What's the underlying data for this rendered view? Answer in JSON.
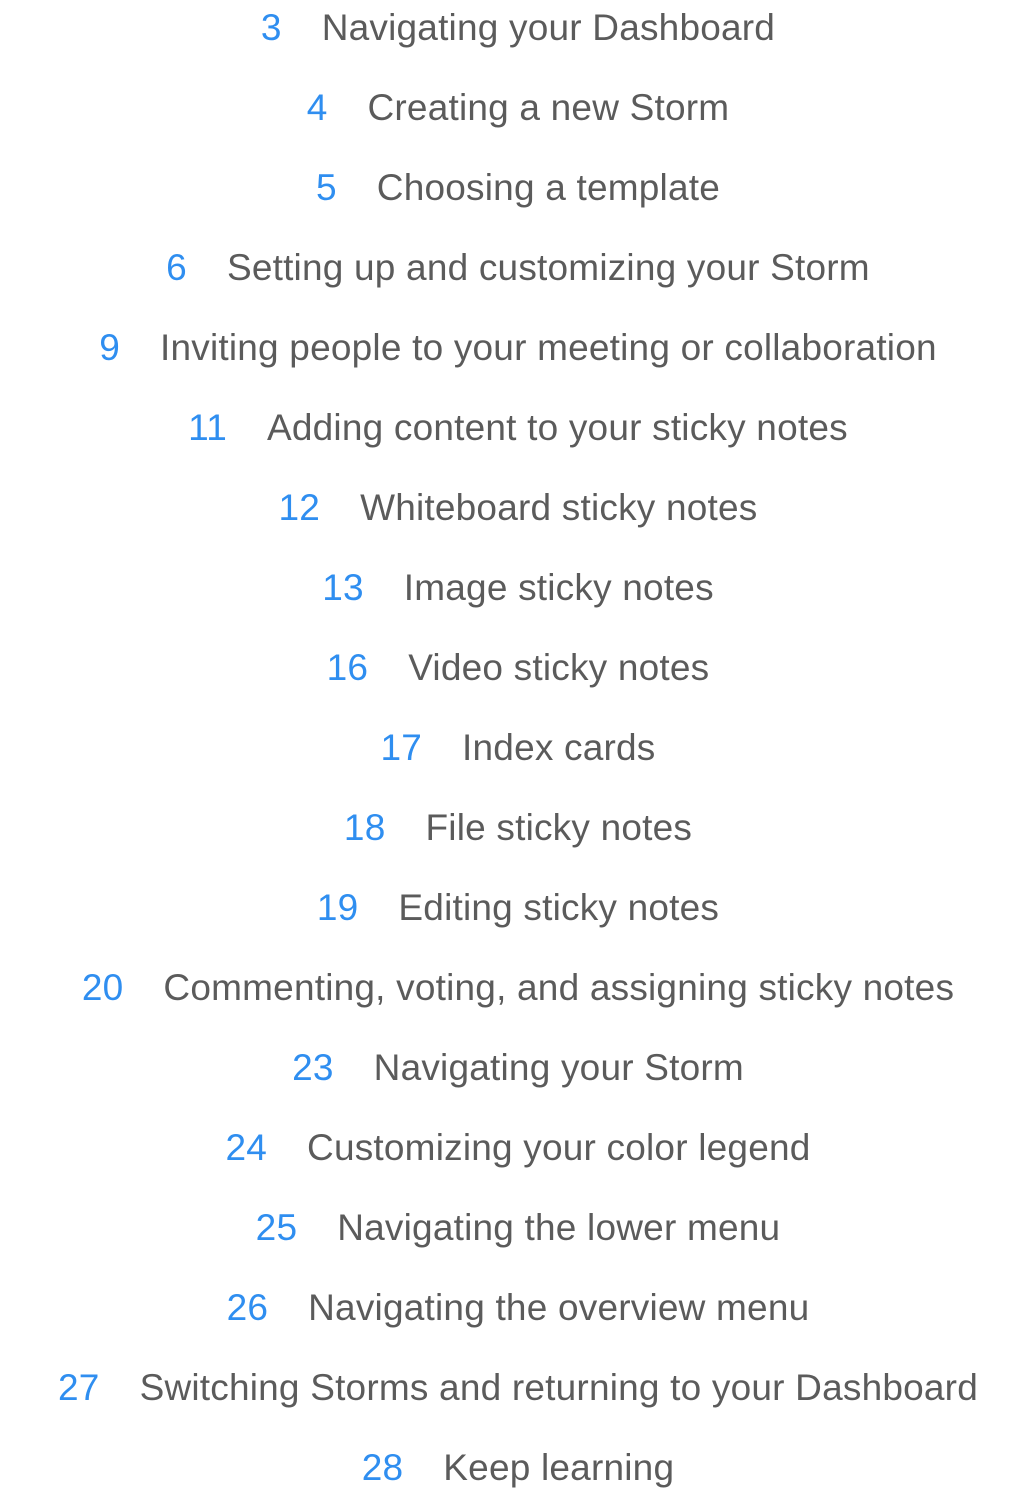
{
  "toc": {
    "accent_color": "#2f8ef0",
    "text_color": "#5b5b5b",
    "entries": [
      {
        "page": "3",
        "title": "Navigating your Dashboard"
      },
      {
        "page": "4",
        "title": "Creating a new Storm"
      },
      {
        "page": "5",
        "title": "Choosing a template"
      },
      {
        "page": "6",
        "title": "Setting up and customizing your Storm"
      },
      {
        "page": "9",
        "title": "Inviting people to your meeting or collaboration"
      },
      {
        "page": "11",
        "title": "Adding content to your sticky notes"
      },
      {
        "page": "12",
        "title": "Whiteboard sticky notes"
      },
      {
        "page": "13",
        "title": "Image sticky notes"
      },
      {
        "page": "16",
        "title": "Video sticky notes"
      },
      {
        "page": "17",
        "title": "Index cards"
      },
      {
        "page": "18",
        "title": "File sticky notes"
      },
      {
        "page": "19",
        "title": "Editing sticky notes"
      },
      {
        "page": "20",
        "title": "Commenting, voting, and assigning sticky notes"
      },
      {
        "page": "23",
        "title": "Navigating your Storm"
      },
      {
        "page": "24",
        "title": "Customizing your color legend"
      },
      {
        "page": "25",
        "title": "Navigating the lower menu"
      },
      {
        "page": "26",
        "title": "Navigating the overview menu"
      },
      {
        "page": "27",
        "title": "Switching Storms and returning to your Dashboard"
      },
      {
        "page": "28",
        "title": "Keep learning"
      }
    ]
  }
}
